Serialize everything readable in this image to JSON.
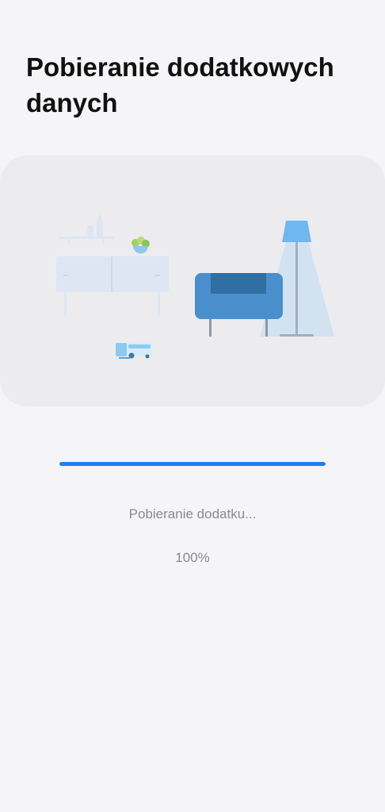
{
  "page": {
    "title": "Pobieranie dodatkowych danych"
  },
  "download": {
    "status_label": "Pobieranie dodatku...",
    "progress_label": "100%",
    "progress_fraction": 1.0
  },
  "colors": {
    "background": "#f5f5f7",
    "card": "#ececef",
    "accent": "#1b7ef2",
    "muted_text": "#8a8a8e"
  }
}
